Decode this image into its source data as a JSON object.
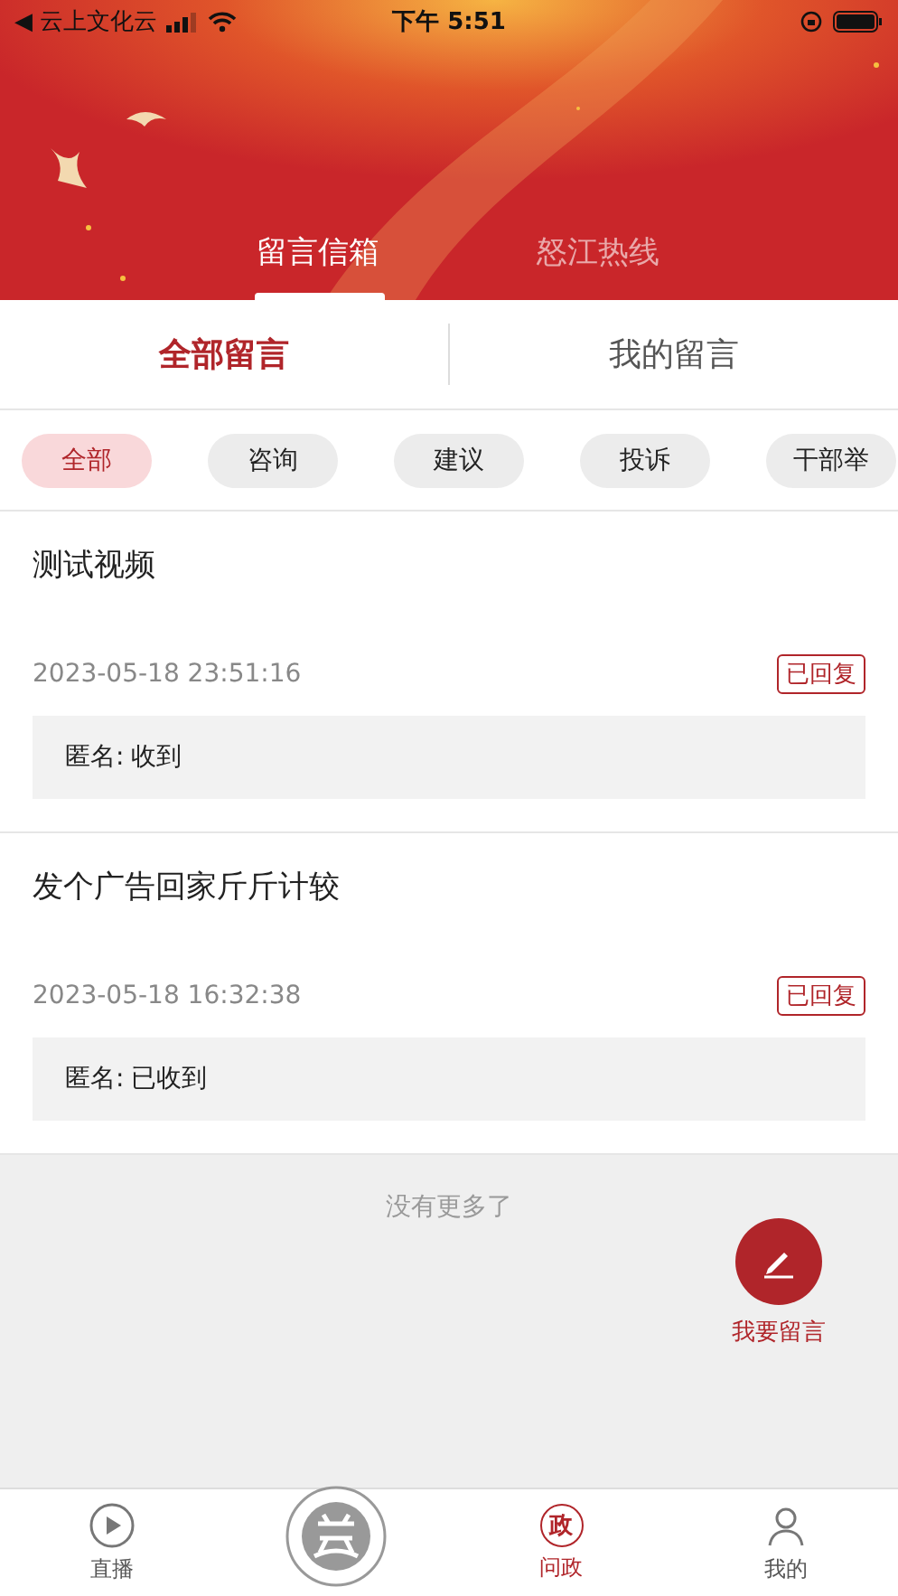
{
  "status_bar": {
    "back_label": "◀ 云上文化云",
    "time": "下午 5:51"
  },
  "header_tabs": [
    {
      "label": "留言信箱",
      "selected": true
    },
    {
      "label": "怒江热线",
      "selected": false
    }
  ],
  "sub_tabs": [
    {
      "label": "全部留言",
      "selected": true
    },
    {
      "label": "我的留言",
      "selected": false
    }
  ],
  "filters": [
    {
      "label": "全部",
      "selected": true
    },
    {
      "label": "咨询",
      "selected": false
    },
    {
      "label": "建议",
      "selected": false
    },
    {
      "label": "投诉",
      "selected": false
    },
    {
      "label": "干部举",
      "selected": false
    }
  ],
  "messages": [
    {
      "title": "测试视频",
      "time": "2023-05-18 23:51:16",
      "status": "已回复",
      "reply_label": "匿名:",
      "reply": "收到"
    },
    {
      "title": "发个广告回家斤斤计较",
      "time": "2023-05-18 16:32:38",
      "status": "已回复",
      "reply_label": "匿名:",
      "reply": "已收到"
    }
  ],
  "end_note": "没有更多了",
  "fab": {
    "label": "我要留言"
  },
  "bottom_tabs": [
    {
      "kind": "play",
      "label": "直播",
      "selected": false
    },
    {
      "kind": "logo",
      "selected": false
    },
    {
      "kind": "glyph",
      "glyph": "政",
      "label": "问政",
      "selected": true
    },
    {
      "kind": "person",
      "label": "我的",
      "selected": false
    }
  ]
}
